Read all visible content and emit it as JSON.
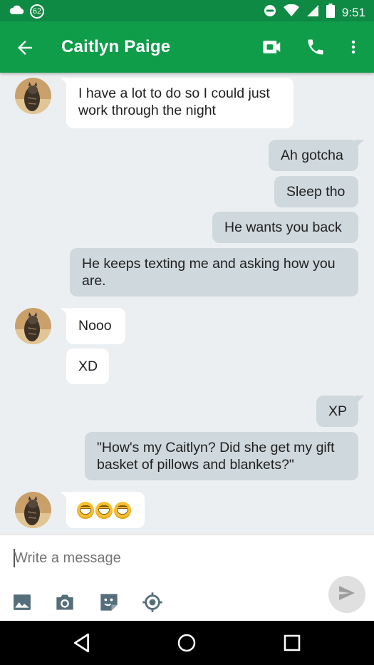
{
  "status_bar": {
    "notification_count": "62",
    "time": "9:51",
    "icons": [
      "cloud-icon",
      "do-not-disturb-icon",
      "wifi-icon",
      "cell-signal-icon",
      "battery-icon"
    ]
  },
  "header": {
    "title": "Caitlyn Paige",
    "icons": [
      "back-arrow-icon",
      "video-call-icon",
      "phone-icon",
      "more-vert-icon"
    ]
  },
  "messages": [
    {
      "dir": "in",
      "text_lines": [
        "I have a lot to do so I could just",
        "work through the night"
      ]
    },
    {
      "dir": "out",
      "text": "Ah gotcha"
    },
    {
      "dir": "out",
      "text": "Sleep tho"
    },
    {
      "dir": "out",
      "text": "He wants you back"
    },
    {
      "dir": "out",
      "text_lines": [
        "He keeps texting me and asking how you",
        "are."
      ]
    },
    {
      "dir": "in",
      "text": "Nooo"
    },
    {
      "dir": "in",
      "text": "XD"
    },
    {
      "dir": "out",
      "text": "XP"
    },
    {
      "dir": "out",
      "text_lines": [
        "\"How's my Caitlyn? Did she get my gift",
        "basket of pillows and blankets?\""
      ]
    },
    {
      "dir": "in",
      "emoji": [
        "grinning-face",
        "grinning-face",
        "grinning-face"
      ]
    }
  ],
  "composer": {
    "placeholder": "Write a message",
    "tools": [
      "image-icon",
      "camera-icon",
      "sticker-icon",
      "location-icon"
    ],
    "send_icon": "send-icon"
  },
  "colors": {
    "status_bar": "#0f8a44",
    "app_bar": "#0f9d4a",
    "background": "#eceff1",
    "outgoing_bubble": "#cfd8dc",
    "incoming_bubble": "#ffffff"
  }
}
